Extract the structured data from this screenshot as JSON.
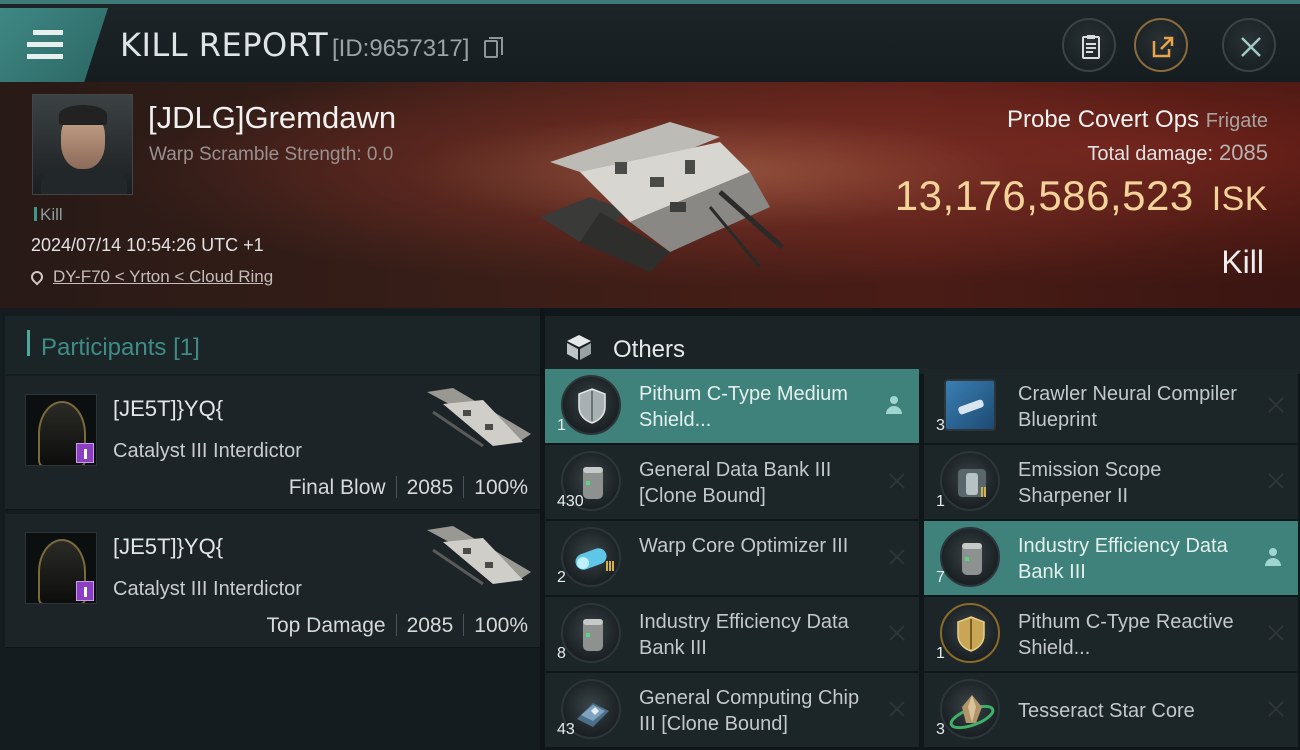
{
  "header": {
    "title": "KILL REPORT",
    "report_id": "[ID:9657317]"
  },
  "victim": {
    "name": "[JDLG]Gremdawn",
    "scramble": "Warp Scramble Strength: 0.0",
    "result_tag": "Kill",
    "datetime": "2024/07/14 10:54:26 UTC +1",
    "location": "DY-F70 < Yrton < Cloud Ring",
    "ship_name": "Probe Covert Ops",
    "ship_class": "Frigate",
    "total_damage_label": "Total damage:",
    "total_damage": "2085",
    "isk_value": "13,176,586,523",
    "isk_unit": "ISK",
    "result": "Kill"
  },
  "participants": {
    "title": "Participants",
    "count": "[1]",
    "rows": [
      {
        "name": "[JE5T]}YQ{",
        "ship": "Catalyst III Interdictor",
        "role": "Final Blow",
        "damage": "2085",
        "percent": "100%"
      },
      {
        "name": "[JE5T]}YQ{",
        "ship": "Catalyst III Interdictor",
        "role": "Top Damage",
        "damage": "2085",
        "percent": "100%"
      }
    ]
  },
  "others": {
    "title": "Others",
    "items": [
      {
        "name": "Pithum C-Type Medium Shield...",
        "qty": "1",
        "icon": "shield-booster-icon",
        "highlight": true
      },
      {
        "name": "Crawler Neural Compiler Blueprint",
        "qty": "3",
        "icon": "blueprint-icon",
        "highlight": false
      },
      {
        "name": "General Data Bank III [Clone Bound]",
        "qty": "430",
        "icon": "data-bank-icon",
        "highlight": false
      },
      {
        "name": "Emission Scope Sharpener II",
        "qty": "1",
        "icon": "scope-sharpener-icon",
        "highlight": false
      },
      {
        "name": "Warp Core Optimizer III",
        "qty": "2",
        "icon": "warp-core-icon",
        "highlight": false
      },
      {
        "name": "Industry Efficiency Data Bank III",
        "qty": "7",
        "icon": "data-bank-icon",
        "highlight": true
      },
      {
        "name": "Industry Efficiency Data Bank III",
        "qty": "8",
        "icon": "data-bank-icon",
        "highlight": false
      },
      {
        "name": "Pithum C-Type Reactive Shield...",
        "qty": "1",
        "icon": "shield-hardener-icon",
        "highlight": false
      },
      {
        "name": "General Computing Chip III [Clone Bound]",
        "qty": "43",
        "icon": "computing-chip-icon",
        "highlight": false
      },
      {
        "name": "Tesseract Star Core",
        "qty": "3",
        "icon": "star-core-icon",
        "highlight": false
      }
    ]
  },
  "colors": {
    "accent": "#3f8884",
    "isk": "#f3d39a",
    "highlight_row": "#3f827c"
  }
}
